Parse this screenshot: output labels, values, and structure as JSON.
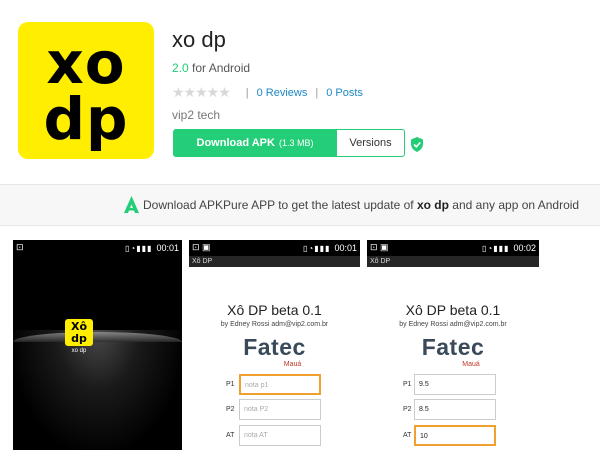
{
  "app": {
    "icon_line1": "xo",
    "icon_line2": "dp",
    "title": "xo dp",
    "version": "2.0",
    "platform": "for Android",
    "stars": "★★★★★",
    "reviews": "0 Reviews",
    "posts": "0 Posts",
    "developer": "vip2 tech",
    "download_label": "Download APK",
    "download_size": "(1.3 MB)",
    "versions_label": "Versions"
  },
  "banner": {
    "prefix": "Download APKPure APP to get the latest update of ",
    "app_name": "xo dp",
    "suffix": " and any app on Android"
  },
  "screenshots": [
    {
      "time": "00:01",
      "logo_line1": "Xô",
      "logo_line2": "dp",
      "logo_label": "xo dp"
    },
    {
      "time": "00:01",
      "appbar": "Xô DP",
      "title": "Xô DP beta 0.1",
      "subtitle": "by Edney Rossi  adm@vip2.com.br",
      "brand": "Fatec",
      "brand_sub": "Mauá",
      "fields": [
        {
          "label": "P1",
          "placeholder": "nota p1"
        },
        {
          "label": "P2",
          "placeholder": "nota P2"
        },
        {
          "label": "AT",
          "placeholder": "nota AT"
        }
      ]
    },
    {
      "time": "00:02",
      "appbar": "Xô DP",
      "title": "Xô DP beta 0.1",
      "subtitle": "by Edney Rossi  adm@vip2.com.br",
      "brand": "Fatec",
      "brand_sub": "Mauá",
      "fields": [
        {
          "label": "P1",
          "value": "9.5"
        },
        {
          "label": "P2",
          "value": "8.5"
        },
        {
          "label": "AT",
          "value": "10"
        }
      ]
    }
  ],
  "colors": {
    "accent_green": "#24cd77",
    "icon_yellow": "#ffee00",
    "link_blue": "#1e88c5"
  }
}
